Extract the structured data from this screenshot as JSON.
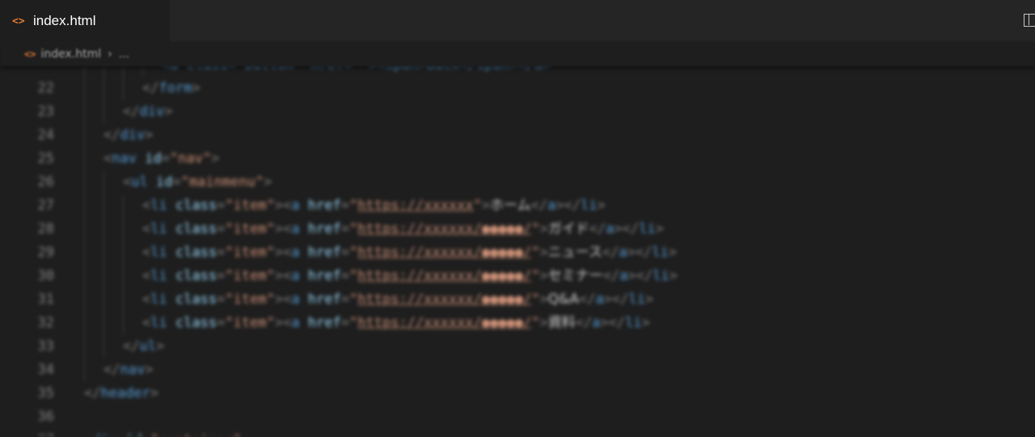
{
  "tab": {
    "icon": "<>",
    "label": "index.html"
  },
  "breadcrumb": {
    "icon": "<>",
    "file": "index.html",
    "separator": "›",
    "more": "..."
  },
  "lines": [
    {
      "num": "",
      "indent": 4,
      "parts": [
        [
          "t",
          "<a class=\"button\" href=\"\"><span>Back</span></a>"
        ]
      ]
    },
    {
      "num": "22",
      "indent": 3,
      "parts": [
        [
          "p",
          "</"
        ],
        [
          "t",
          "form"
        ],
        [
          "p",
          ">"
        ]
      ]
    },
    {
      "num": "23",
      "indent": 2,
      "parts": [
        [
          "p",
          "</"
        ],
        [
          "t",
          "div"
        ],
        [
          "p",
          ">"
        ]
      ]
    },
    {
      "num": "24",
      "indent": 1,
      "parts": [
        [
          "p",
          "</"
        ],
        [
          "t",
          "div"
        ],
        [
          "p",
          ">"
        ]
      ]
    },
    {
      "num": "25",
      "indent": 1,
      "parts": [
        [
          "p",
          "<"
        ],
        [
          "t",
          "nav"
        ],
        [
          "a",
          " id"
        ],
        [
          "p",
          "="
        ],
        [
          "s",
          "\"nav\""
        ],
        [
          "p",
          ">"
        ]
      ]
    },
    {
      "num": "26",
      "indent": 2,
      "parts": [
        [
          "p",
          "<"
        ],
        [
          "t",
          "ul"
        ],
        [
          "a",
          " id"
        ],
        [
          "p",
          "="
        ],
        [
          "s",
          "\"mainmenu\""
        ],
        [
          "p",
          ">"
        ]
      ]
    },
    {
      "num": "27",
      "indent": 3,
      "parts": [
        [
          "p",
          "<"
        ],
        [
          "t",
          "li"
        ],
        [
          "a",
          " class"
        ],
        [
          "p",
          "="
        ],
        [
          "s",
          "\"item\""
        ],
        [
          "p",
          "><"
        ],
        [
          "t",
          "a"
        ],
        [
          "a",
          " href"
        ],
        [
          "p",
          "="
        ],
        [
          "s",
          "\""
        ],
        [
          "u",
          "https://xxxxxx"
        ],
        [
          "s",
          "\""
        ],
        [
          "p",
          ">"
        ],
        [
          "tx",
          "ホーム"
        ],
        [
          "p",
          "</"
        ],
        [
          "t",
          "a"
        ],
        [
          "p",
          "></"
        ],
        [
          "t",
          "li"
        ],
        [
          "p",
          ">"
        ]
      ]
    },
    {
      "num": "28",
      "indent": 3,
      "parts": [
        [
          "p",
          "<"
        ],
        [
          "t",
          "li"
        ],
        [
          "a",
          " class"
        ],
        [
          "p",
          "="
        ],
        [
          "s",
          "\"item\""
        ],
        [
          "p",
          "><"
        ],
        [
          "t",
          "a"
        ],
        [
          "a",
          " href"
        ],
        [
          "p",
          "="
        ],
        [
          "s",
          "\""
        ],
        [
          "u",
          "https://xxxxxx/●●●●●/"
        ],
        [
          "s",
          "\""
        ],
        [
          "p",
          ">"
        ],
        [
          "tx",
          "ガイド"
        ],
        [
          "p",
          "</"
        ],
        [
          "t",
          "a"
        ],
        [
          "p",
          "></"
        ],
        [
          "t",
          "li"
        ],
        [
          "p",
          ">"
        ]
      ]
    },
    {
      "num": "29",
      "indent": 3,
      "parts": [
        [
          "p",
          "<"
        ],
        [
          "t",
          "li"
        ],
        [
          "a",
          " class"
        ],
        [
          "p",
          "="
        ],
        [
          "s",
          "\"item\""
        ],
        [
          "p",
          "><"
        ],
        [
          "t",
          "a"
        ],
        [
          "a",
          " href"
        ],
        [
          "p",
          "="
        ],
        [
          "s",
          "\""
        ],
        [
          "u",
          "https://xxxxxx/●●●●●/"
        ],
        [
          "s",
          "\""
        ],
        [
          "p",
          ">"
        ],
        [
          "tx",
          "ニュース"
        ],
        [
          "p",
          "</"
        ],
        [
          "t",
          "a"
        ],
        [
          "p",
          "></"
        ],
        [
          "t",
          "li"
        ],
        [
          "p",
          ">"
        ]
      ]
    },
    {
      "num": "30",
      "indent": 3,
      "parts": [
        [
          "p",
          "<"
        ],
        [
          "t",
          "li"
        ],
        [
          "a",
          " class"
        ],
        [
          "p",
          "="
        ],
        [
          "s",
          "\"item\""
        ],
        [
          "p",
          "><"
        ],
        [
          "t",
          "a"
        ],
        [
          "a",
          " href"
        ],
        [
          "p",
          "="
        ],
        [
          "s",
          "\""
        ],
        [
          "u",
          "https://xxxxxx/●●●●●/"
        ],
        [
          "s",
          "\""
        ],
        [
          "p",
          ">"
        ],
        [
          "tx",
          "セミナー"
        ],
        [
          "p",
          "</"
        ],
        [
          "t",
          "a"
        ],
        [
          "p",
          "></"
        ],
        [
          "t",
          "li"
        ],
        [
          "p",
          ">"
        ]
      ]
    },
    {
      "num": "31",
      "indent": 3,
      "parts": [
        [
          "p",
          "<"
        ],
        [
          "t",
          "li"
        ],
        [
          "a",
          " class"
        ],
        [
          "p",
          "="
        ],
        [
          "s",
          "\"item\""
        ],
        [
          "p",
          "><"
        ],
        [
          "t",
          "a"
        ],
        [
          "a",
          " href"
        ],
        [
          "p",
          "="
        ],
        [
          "s",
          "\""
        ],
        [
          "u",
          "https://xxxxxx/●●●●●/"
        ],
        [
          "s",
          "\""
        ],
        [
          "p",
          ">"
        ],
        [
          "tx",
          "Q&A"
        ],
        [
          "p",
          "</"
        ],
        [
          "t",
          "a"
        ],
        [
          "p",
          "></"
        ],
        [
          "t",
          "li"
        ],
        [
          "p",
          ">"
        ]
      ]
    },
    {
      "num": "32",
      "indent": 3,
      "parts": [
        [
          "p",
          "<"
        ],
        [
          "t",
          "li"
        ],
        [
          "a",
          " class"
        ],
        [
          "p",
          "="
        ],
        [
          "s",
          "\"item\""
        ],
        [
          "p",
          "><"
        ],
        [
          "t",
          "a"
        ],
        [
          "a",
          " href"
        ],
        [
          "p",
          "="
        ],
        [
          "s",
          "\""
        ],
        [
          "u",
          "https://xxxxxx/●●●●●/"
        ],
        [
          "s",
          "\""
        ],
        [
          "p",
          ">"
        ],
        [
          "tx",
          "資料"
        ],
        [
          "p",
          "</"
        ],
        [
          "t",
          "a"
        ],
        [
          "p",
          "></"
        ],
        [
          "t",
          "li"
        ],
        [
          "p",
          ">"
        ]
      ]
    },
    {
      "num": "33",
      "indent": 2,
      "parts": [
        [
          "p",
          "</"
        ],
        [
          "t",
          "ul"
        ],
        [
          "p",
          ">"
        ]
      ]
    },
    {
      "num": "34",
      "indent": 1,
      "parts": [
        [
          "p",
          "</"
        ],
        [
          "t",
          "nav"
        ],
        [
          "p",
          ">"
        ]
      ]
    },
    {
      "num": "35",
      "indent": 0,
      "parts": [
        [
          "p",
          "</"
        ],
        [
          "t",
          "header"
        ],
        [
          "p",
          ">"
        ]
      ]
    },
    {
      "num": "36",
      "indent": 0,
      "parts": []
    },
    {
      "num": "37",
      "indent": 0,
      "parts": [
        [
          "p",
          "<"
        ],
        [
          "t",
          "div"
        ],
        [
          "a",
          " id"
        ],
        [
          "p",
          "="
        ],
        [
          "s",
          "\"container\""
        ],
        [
          "p",
          ">"
        ]
      ]
    }
  ]
}
